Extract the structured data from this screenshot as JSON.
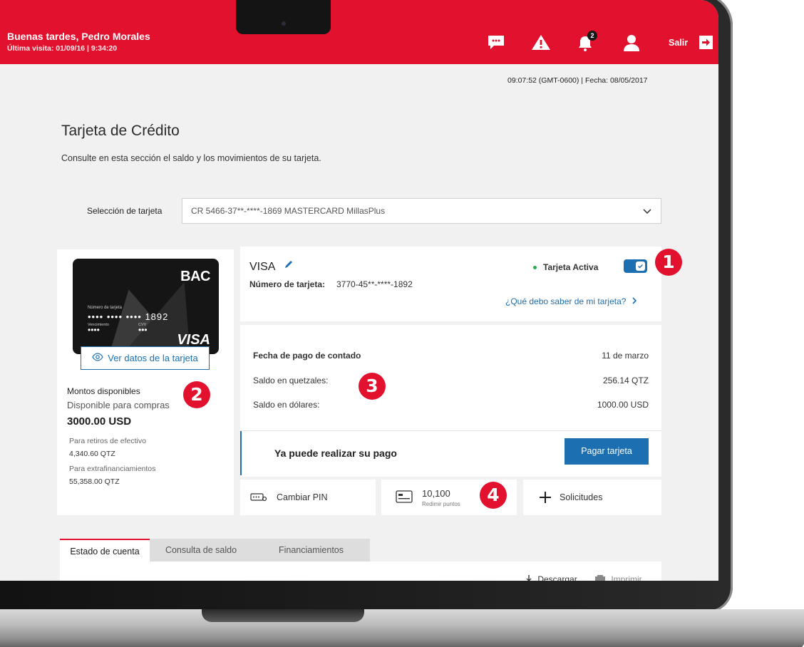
{
  "header": {
    "greeting": "Buenas tardes, Pedro Morales",
    "last_visit": "Última visita: 01/09/16  |  9:34:20",
    "notifications_count": "2",
    "logout_label": "Salir",
    "brand_color": "#e2112e",
    "icons": [
      "chat-icon",
      "warning-icon",
      "bell-icon",
      "user-icon",
      "logout-icon"
    ]
  },
  "datetime": "09:07:52 (GMT-0600) | Fecha: 08/05/2017",
  "page": {
    "title": "Tarjeta de Crédito",
    "subtitle": "Consulte en esta sección el saldo y los movimientos de su tarjeta."
  },
  "card_select": {
    "label": "Selección de tarjeta",
    "value": "CR 5466-37**-****-1869 MASTERCARD MillasPlus"
  },
  "card_image": {
    "brand": "BAC",
    "number_label": "Número de tarjeta",
    "number_masked": "•••• •••• •••• 1892",
    "expiry_label": "Vencimiento",
    "expiry_masked": "••••",
    "cvv_label": "CVV",
    "cvv_masked": "•••",
    "network": "VISA"
  },
  "view_card_button": "Ver datos de la tarjeta",
  "available": {
    "title": "Montos disponibles",
    "purchase_label": "Disponible para compras",
    "purchase_value": "3000.00 USD",
    "cash_label": "Para retiros de efectivo",
    "cash_value": "4,340.60  QTZ",
    "extra_label": "Para extrafinanciamientos",
    "extra_value": "55,358.00  QTZ"
  },
  "card_info": {
    "type": "VISA",
    "number_label": "Número de tarjeta:",
    "number_value": "3770-45**-****-1892",
    "status_label": "Tarjeta Activa",
    "status_active": true,
    "help_link": "¿Qué debo saber de mi tarjeta?"
  },
  "payment": {
    "due_label": "Fecha de pago de contado",
    "due_value": "11 de marzo",
    "gtq_label": "Saldo en quetzales:",
    "gtq_value": "256.14 QTZ",
    "usd_label": "Saldo en dólares:",
    "usd_value": "1000.00 USD",
    "ready_text": "Ya puede realizar su pago",
    "pay_button": "Pagar tarjeta",
    "accent_color": "#1c6fb1"
  },
  "actions": {
    "change_pin": "Cambiar PIN",
    "points_value": "10,100",
    "points_label": "Redimir puntos",
    "requests": "Solicitudes"
  },
  "callouts": [
    "1",
    "2",
    "3",
    "4"
  ],
  "tabs": [
    "Estado de cuenta",
    "Consulta de saldo",
    "Financiamientos"
  ],
  "tab_actions": {
    "download": "Descargar",
    "print": "Imprimir"
  }
}
